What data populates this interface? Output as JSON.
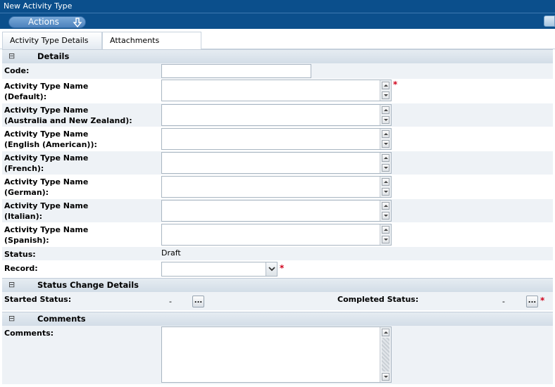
{
  "window": {
    "title": "New Activity Type"
  },
  "toolbar": {
    "actions_label": "Actions"
  },
  "tabs": [
    {
      "label": "Activity Type Details",
      "active": true
    },
    {
      "label": "Attachments",
      "active": false
    }
  ],
  "details": {
    "header": "Details",
    "toggle": "⊟",
    "code": {
      "label": "Code:",
      "value": ""
    },
    "names": [
      {
        "label_line1": "Activity Type Name",
        "label_line2": "(Default):",
        "value": "",
        "required": true
      },
      {
        "label_line1": "Activity Type Name",
        "label_line2": "(Australia and New Zealand):",
        "value": "",
        "required": false
      },
      {
        "label_line1": "Activity Type Name",
        "label_line2": "(English (American)):",
        "value": "",
        "required": false
      },
      {
        "label_line1": "Activity Type Name",
        "label_line2": "(French):",
        "value": "",
        "required": false
      },
      {
        "label_line1": "Activity Type Name",
        "label_line2": "(German):",
        "value": "",
        "required": false
      },
      {
        "label_line1": "Activity Type Name",
        "label_line2": "(Italian):",
        "value": "",
        "required": false
      },
      {
        "label_line1": "Activity Type Name",
        "label_line2": "(Spanish):",
        "value": "",
        "required": false
      }
    ],
    "status": {
      "label": "Status:",
      "value": "Draft"
    },
    "record": {
      "label": "Record:",
      "value": "",
      "required": true
    }
  },
  "status_change": {
    "header": "Status Change Details",
    "toggle": "⊟",
    "started": {
      "label": "Started Status:",
      "value": "-",
      "button": "..."
    },
    "completed": {
      "label": "Completed Status:",
      "value": "-",
      "button": "...",
      "required": true
    }
  },
  "comments": {
    "header": "Comments",
    "toggle": "⊟",
    "label": "Comments:",
    "value": ""
  },
  "required_marker": "*",
  "colors": {
    "header_bar": "#0b4f8c",
    "required": "#d0021b",
    "row_alt": "#eef2f6"
  }
}
